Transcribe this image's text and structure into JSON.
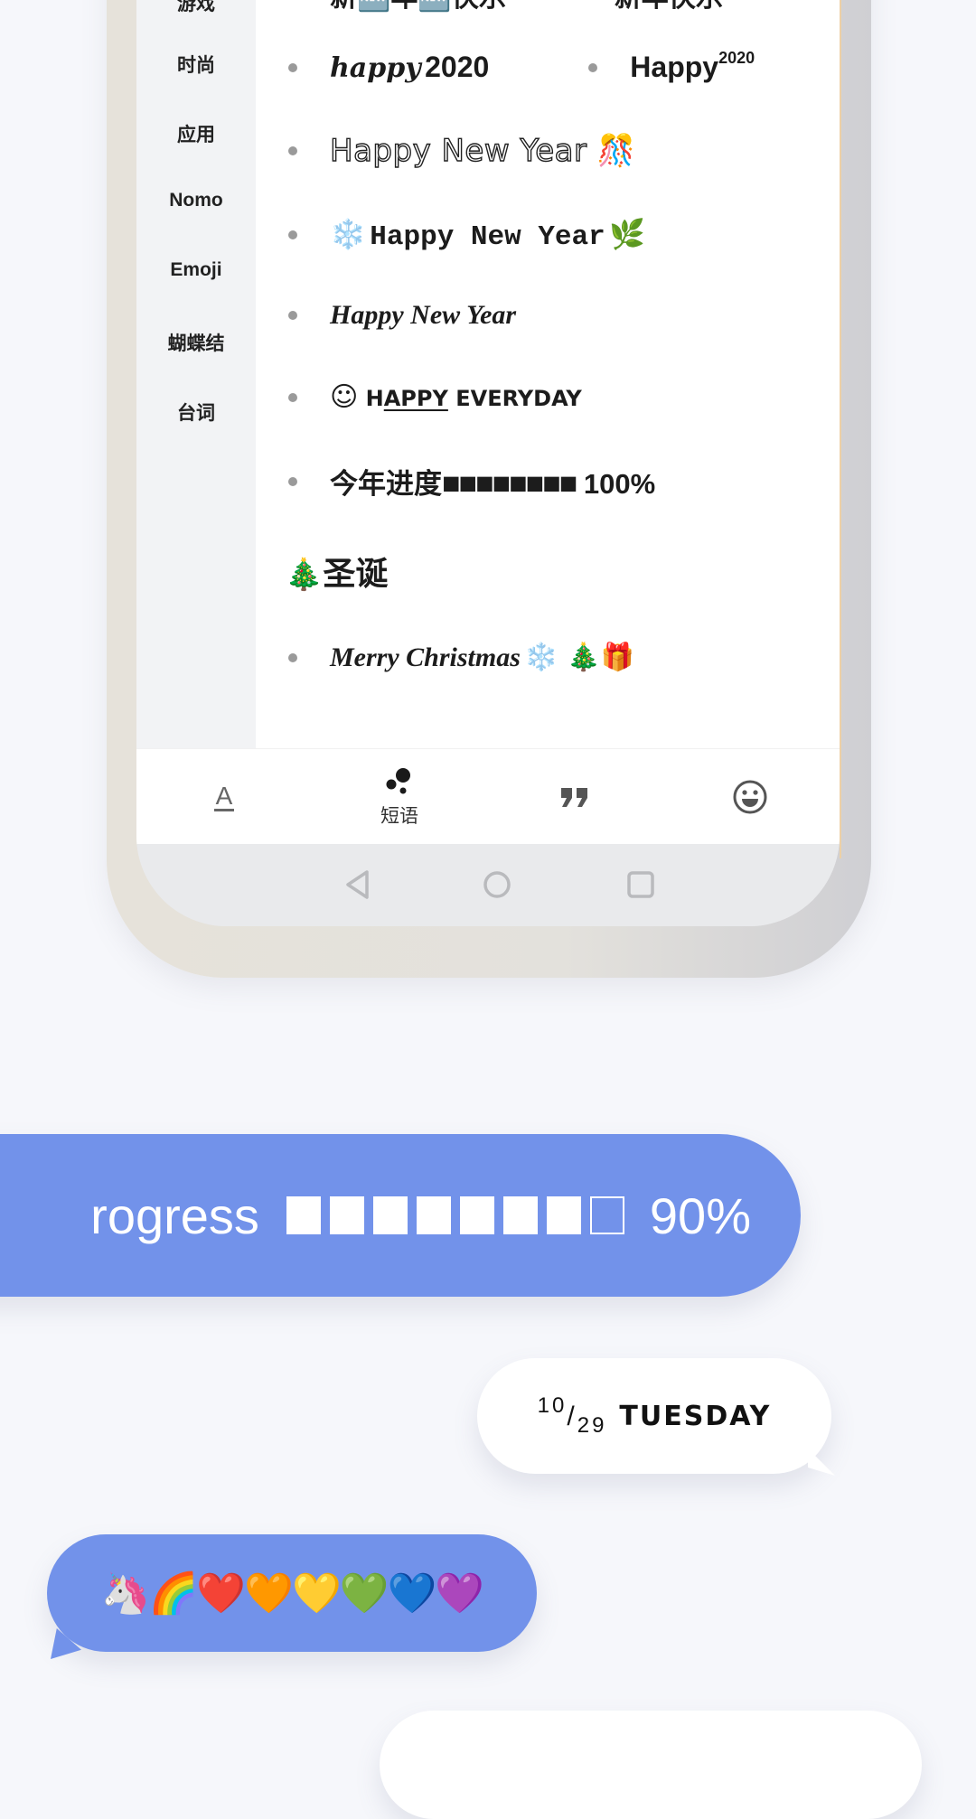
{
  "sidebar": {
    "items": [
      {
        "label": "游戏"
      },
      {
        "label": "时尚"
      },
      {
        "label": "应用"
      },
      {
        "label": "Nomo"
      },
      {
        "label": "Emoji"
      },
      {
        "label": "蝴蝶结"
      },
      {
        "label": "台词"
      }
    ]
  },
  "content": {
    "clipped_top_row": [
      "新🆕年🆕快乐",
      "新年快乐"
    ],
    "phrases": {
      "happy_2020_script": {
        "script": "happy",
        "number": "2020"
      },
      "happy_sup_2020": {
        "word": "Happy",
        "sup": "2020"
      },
      "happy_new_year_outline": "Happy New Year 🎊",
      "happy_new_year_mono": {
        "lead": "❄️",
        "text": "Happy New Year",
        "trail": "🌿"
      },
      "happy_new_year_cursive": "Happy New Year",
      "happy_everyday": {
        "face": "☺",
        "h": "H",
        "underlined": "APPY",
        "rest": " EVERYDAY"
      },
      "year_progress": {
        "label": "今年进度",
        "filled_blocks": 8,
        "total_blocks": 8,
        "percent_text": "100%",
        "progress": 1.0
      }
    },
    "section_christmas": {
      "title_icon": "🎄",
      "title": "圣诞",
      "phrases": [
        {
          "text": "Merry Christmas",
          "emoji": "❄️ 🎄🎁"
        }
      ]
    }
  },
  "tabbar": {
    "tabs": [
      {
        "icon": "font-style-icon",
        "glyph": "A",
        "label": "",
        "active": false
      },
      {
        "icon": "bubbles-icon",
        "label": "短语",
        "active": true
      },
      {
        "icon": "quote-icon",
        "glyph": "❞",
        "label": "",
        "active": false
      },
      {
        "icon": "smiley-icon",
        "glyph": "☺",
        "label": "",
        "active": false
      }
    ]
  },
  "navbar": {
    "buttons": [
      "back",
      "home",
      "recents"
    ]
  },
  "bubbles": {
    "progress": {
      "prefix": "rogress",
      "filled_blocks": 7,
      "empty_blocks": 1,
      "percent_text": "90%",
      "progress": 0.9
    },
    "date": {
      "month": "10",
      "day": "29",
      "weekday": "TUESDAY"
    },
    "emoji_row": "🦄🌈❤️🧡💛💚💙💜"
  },
  "colors": {
    "accent_blue": "#7292ea",
    "background": "#f6f7fb",
    "sidebar_bg": "#f2f3f5",
    "text_dark": "#1c1c1c"
  }
}
